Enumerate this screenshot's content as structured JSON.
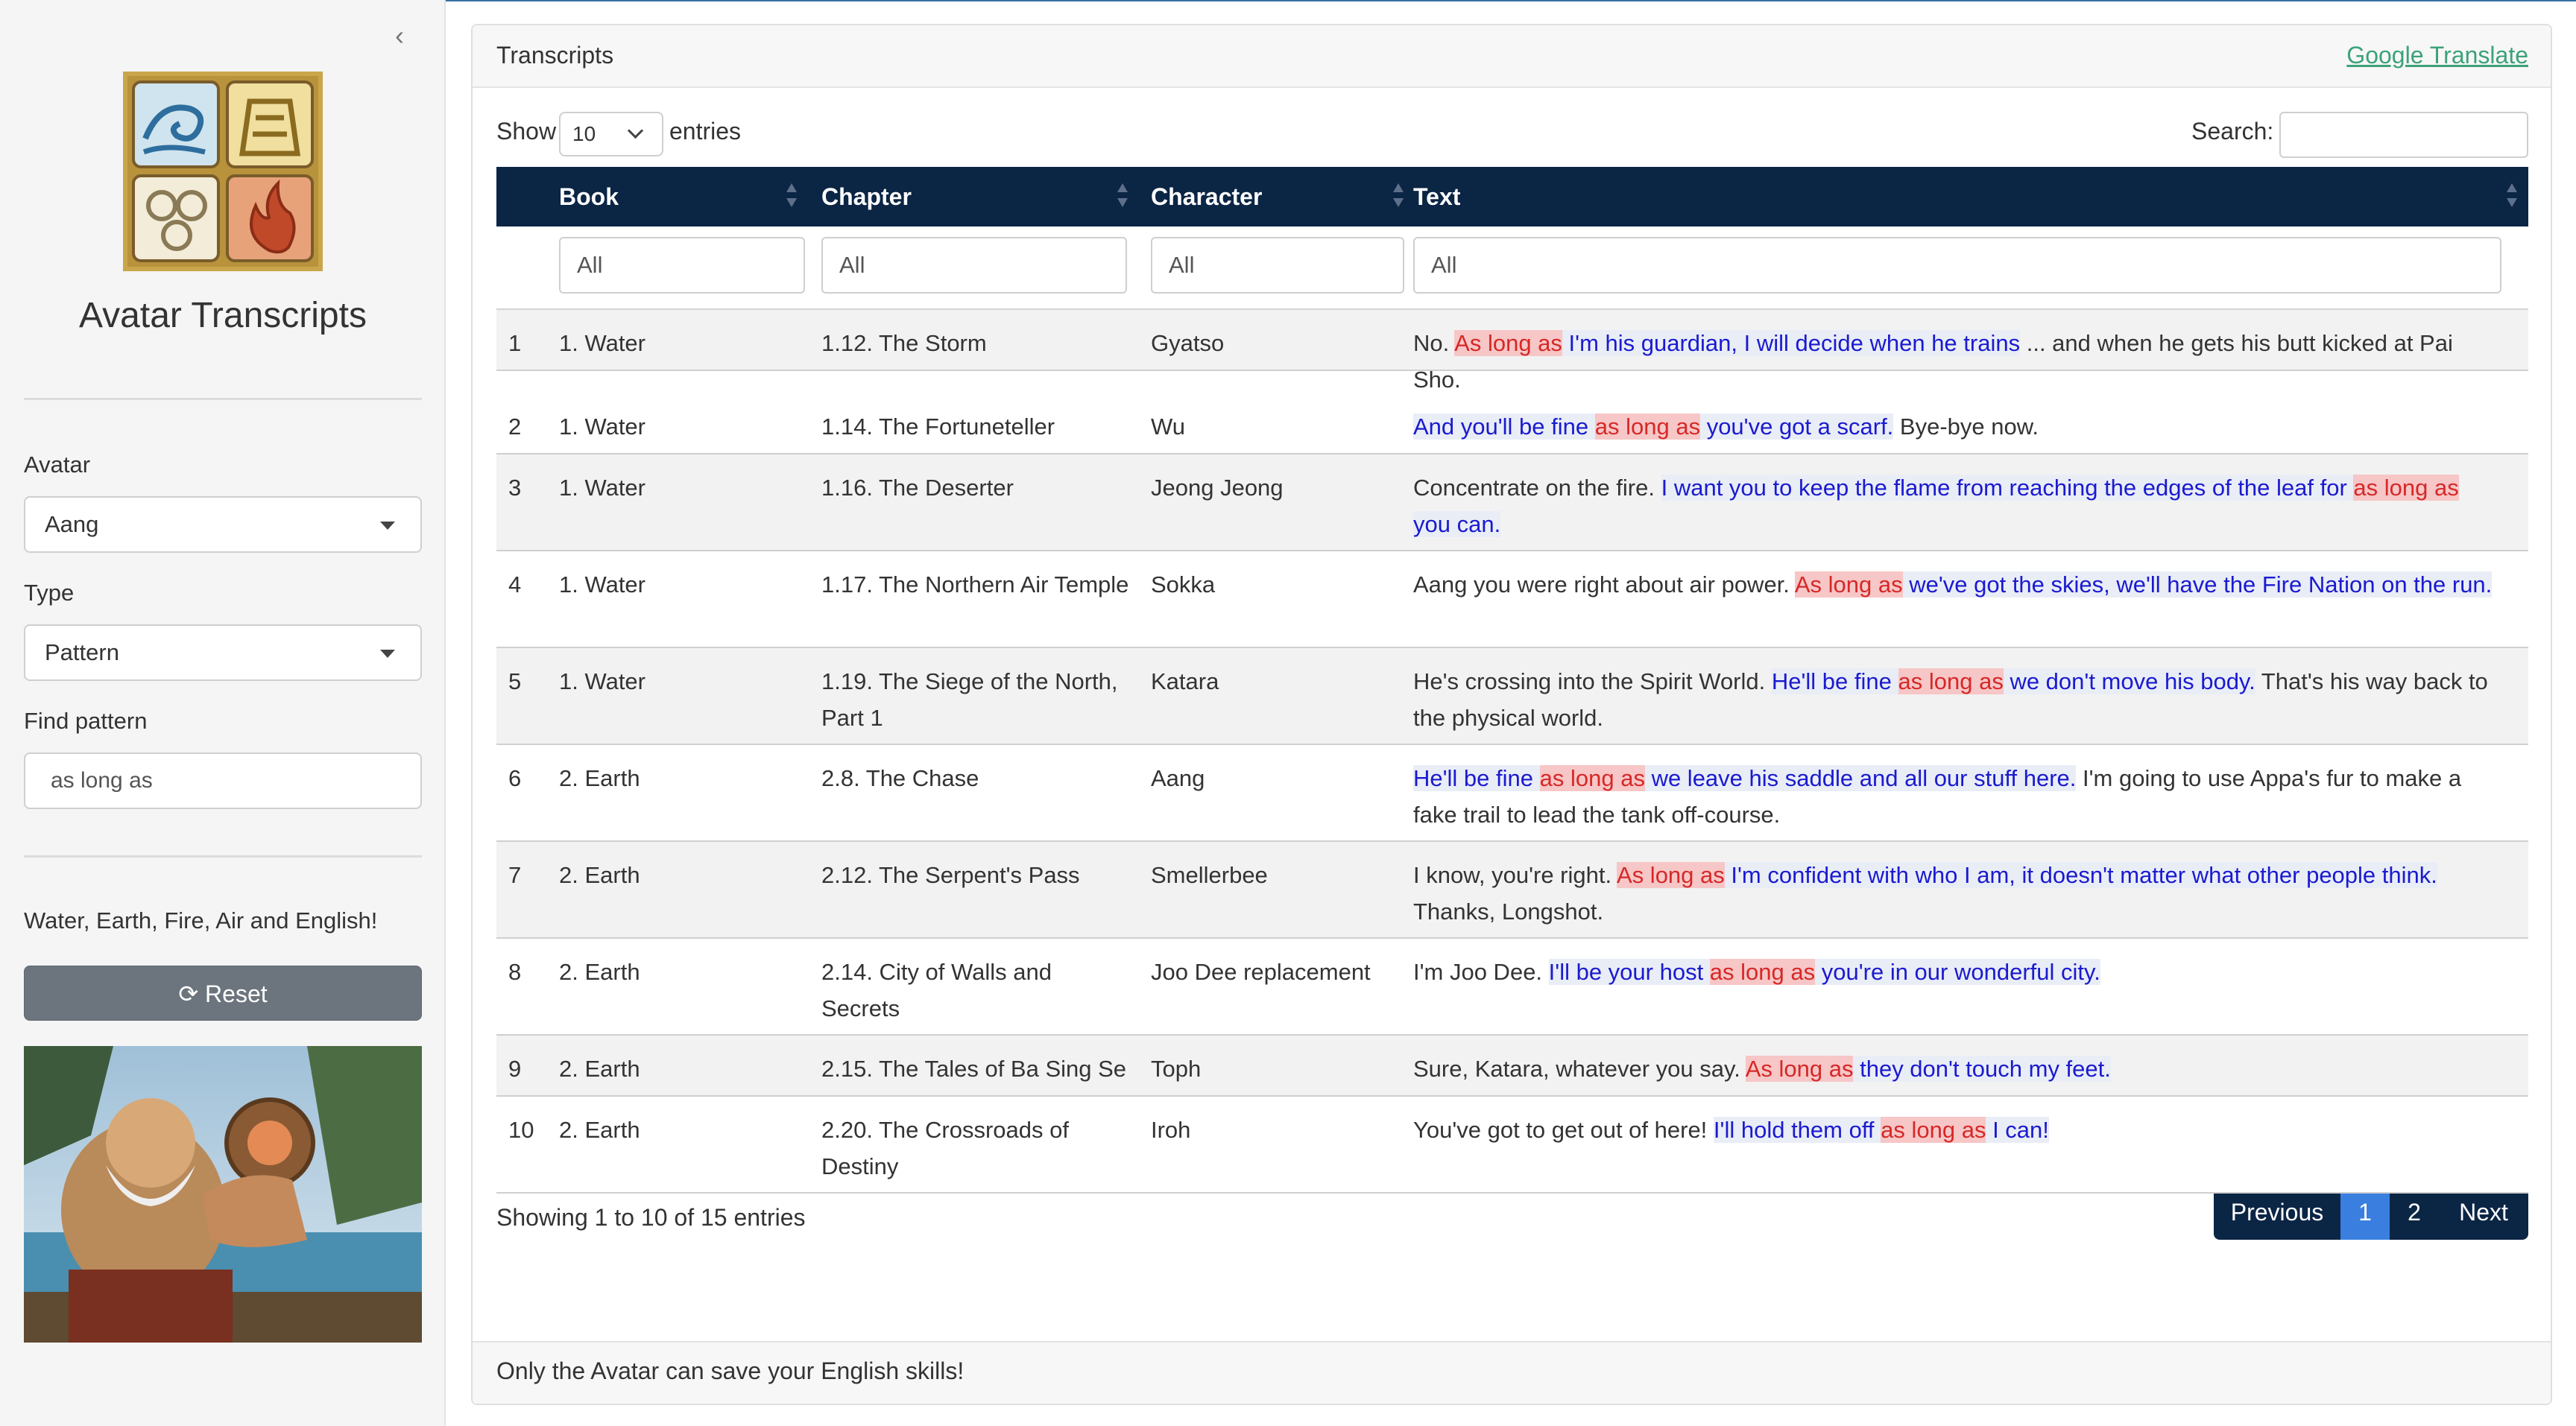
{
  "sidebar": {
    "title": "Avatar Transcripts",
    "avatar_label": "Avatar",
    "avatar_value": "Aang",
    "type_label": "Type",
    "type_value": "Pattern",
    "pattern_label": "Find pattern",
    "pattern_value": "as long as",
    "tagline": "Water, Earth, Fire, Air and English!",
    "reset_label": "Reset"
  },
  "card": {
    "title": "Transcripts",
    "translate_link": "Google Translate",
    "footer": "Only the Avatar can save your English skills!"
  },
  "controls": {
    "show": "Show",
    "page_length": "10",
    "entries": "entries",
    "search_label": "Search:"
  },
  "table": {
    "headers": [
      "Book",
      "Chapter",
      "Character",
      "Text"
    ],
    "filters": [
      "All",
      "All",
      "All",
      "All"
    ],
    "rows": [
      {
        "idx": "1",
        "book": "1. Water",
        "chapter": "1.12. The Storm",
        "character": "Gyatso",
        "text": [
          [
            "No. ",
            ""
          ],
          [
            "As long as",
            "hl"
          ],
          [
            " I'm his guardian, I will decide when he trains",
            "blue"
          ],
          [
            " ... and when he gets his butt kicked at Pai Sho.",
            ""
          ]
        ]
      },
      {
        "idx": "2",
        "book": "1. Water",
        "chapter": "1.14. The Fortuneteller",
        "character": "Wu",
        "text": [
          [
            "And you'll be fine ",
            "blue"
          ],
          [
            "as long as",
            "hl"
          ],
          [
            " you've got a scarf.",
            "blue"
          ],
          [
            " Bye-bye now.",
            ""
          ]
        ]
      },
      {
        "idx": "3",
        "book": "1. Water",
        "chapter": "1.16. The Deserter",
        "character": "Jeong Jeong",
        "text": [
          [
            "Concentrate on the fire. ",
            ""
          ],
          [
            "I want you to keep the flame from reaching the edges of the leaf for ",
            "blue"
          ],
          [
            "as long as",
            "hl"
          ],
          [
            " you can.",
            "blue"
          ]
        ]
      },
      {
        "idx": "4",
        "book": "1. Water",
        "chapter": "1.17. The Northern Air Temple",
        "character": "Sokka",
        "text": [
          [
            "Aang you were right about air power. ",
            ""
          ],
          [
            "As long as",
            "hl"
          ],
          [
            " we've got the skies, we'll have the Fire Nation on the run.",
            "blue"
          ]
        ]
      },
      {
        "idx": "5",
        "book": "1. Water",
        "chapter": "1.19. The Siege of the North, Part 1",
        "character": "Katara",
        "text": [
          [
            "He's crossing into the Spirit World. ",
            ""
          ],
          [
            "He'll be fine ",
            "blue"
          ],
          [
            "as long as",
            "hl"
          ],
          [
            " we don't move his body.",
            "blue"
          ],
          [
            " That's his way back to the physical world.",
            ""
          ]
        ]
      },
      {
        "idx": "6",
        "book": "2. Earth",
        "chapter": "2.8. The Chase",
        "character": "Aang",
        "text": [
          [
            "He'll be fine ",
            "blue"
          ],
          [
            "as long as",
            "hl"
          ],
          [
            " we leave his saddle and all our stuff here.",
            "blue"
          ],
          [
            " I'm going to use Appa's fur to make a fake trail to lead the tank off-course.",
            ""
          ]
        ]
      },
      {
        "idx": "7",
        "book": "2. Earth",
        "chapter": "2.12. The Serpent's Pass",
        "character": "Smellerbee",
        "text": [
          [
            "I know, you're right. ",
            ""
          ],
          [
            "As long as",
            "hl"
          ],
          [
            " I'm confident with who I am, it doesn't matter what other people think.",
            "blue"
          ],
          [
            " Thanks, Longshot.",
            ""
          ]
        ]
      },
      {
        "idx": "8",
        "book": "2. Earth",
        "chapter": "2.14. City of Walls and Secrets",
        "character": "Joo Dee replacement",
        "text": [
          [
            "I'm Joo Dee. ",
            ""
          ],
          [
            "I'll be your host ",
            "blue"
          ],
          [
            "as long as",
            "hl"
          ],
          [
            " you're in our wonderful city.",
            "blue"
          ]
        ]
      },
      {
        "idx": "9",
        "book": "2. Earth",
        "chapter": "2.15. The Tales of Ba Sing Se",
        "character": "Toph",
        "text": [
          [
            "Sure, Katara, whatever you say. ",
            ""
          ],
          [
            "As long as",
            "hl"
          ],
          [
            " they don't touch my feet.",
            "blue"
          ]
        ]
      },
      {
        "idx": "10",
        "book": "2. Earth",
        "chapter": "2.20. The Crossroads of Destiny",
        "character": "Iroh",
        "text": [
          [
            "You've got to get out of here! ",
            ""
          ],
          [
            "I'll hold them off ",
            "blue"
          ],
          [
            "as long as",
            "hl"
          ],
          [
            " I can!",
            "blue"
          ]
        ]
      }
    ]
  },
  "info": "Showing 1 to 10 of 15 entries",
  "pagination": {
    "previous": "Previous",
    "page1": "1",
    "page2": "2",
    "next": "Next"
  },
  "colors": {
    "header_bg": "#0b2545",
    "link": "#3ca279",
    "highlight": "#d62828",
    "match": "#1a1acf",
    "active_page": "#3a7fe0"
  },
  "icons": [
    "chevron-left-icon",
    "element-symbols-logo",
    "refresh-icon",
    "sort-icon",
    "caret-down-icon"
  ]
}
